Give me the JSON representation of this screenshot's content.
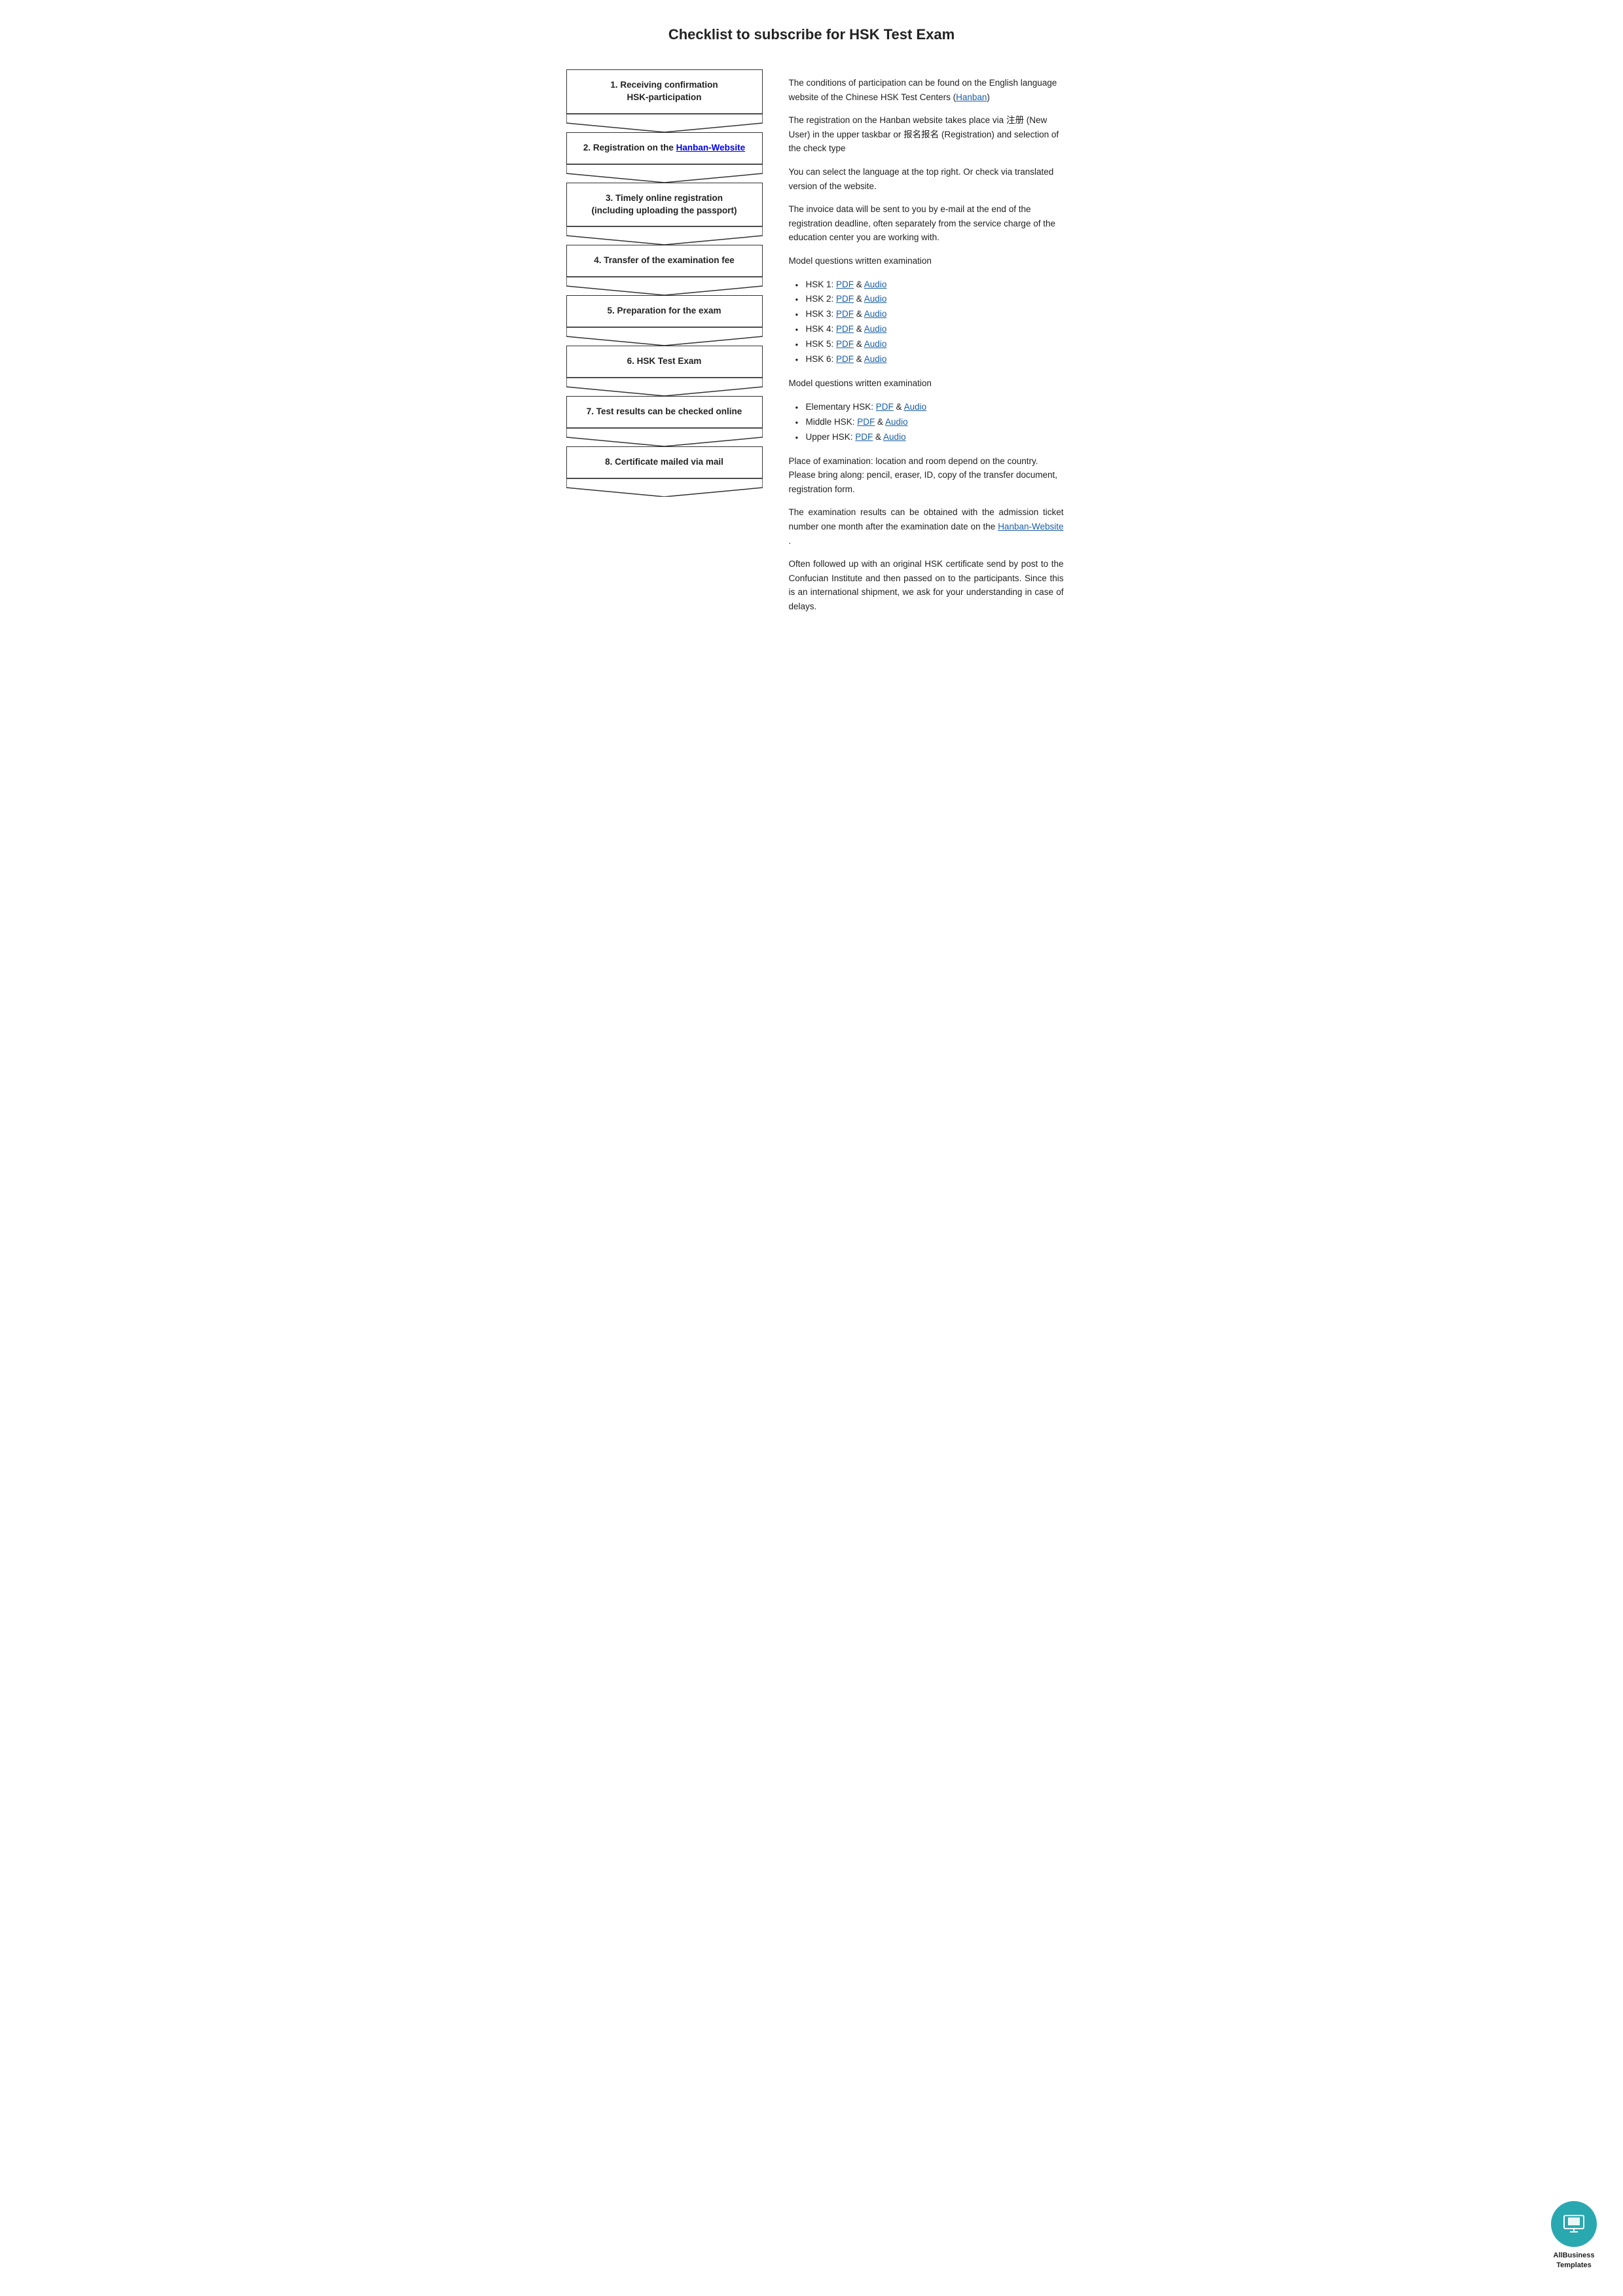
{
  "title": "Checklist to subscribe for HSK Test Exam",
  "steps": [
    {
      "id": 1,
      "label": "1. Receiving confirmation\nHSK-participation"
    },
    {
      "id": 2,
      "label": "2. Registration on the Hanban-\nWebsite",
      "hasLink": true,
      "linkText": "Hanban-\nWebsite",
      "preText": "2. Registration on the ",
      "linkHref": "#"
    },
    {
      "id": 3,
      "label": "3. Timely online registration\n(including uploading the passport)"
    },
    {
      "id": 4,
      "label": "4. Transfer of the examination fee"
    },
    {
      "id": 5,
      "label": "5. Preparation for the exam"
    },
    {
      "id": 6,
      "label": "6. HSK Test Exam"
    },
    {
      "id": 7,
      "label": "7. Test results can be checked online"
    },
    {
      "id": 8,
      "label": "8. Certificate mailed via mail"
    }
  ],
  "right": {
    "para1": "The conditions of participation can be found on the English language website of the Chinese HSK Test Centers  (",
    "para1_link": "Hanban",
    "para1_end": ")",
    "para2": "The registration on the Hanban website takes place via 注册 (New User) in the upper taskbar or 报名报名 (Registration) and selection of the check type",
    "para3": "You can select the language at the top right. Or check via translated version of the website.",
    "para4": "The invoice data will be sent to you by e-mail at the end of the registration deadline, often separately from the service charge of the education center you are working with.",
    "section1_label": "Model questions written examination",
    "hsk_items": [
      {
        "label": "HSK 1: ",
        "link1": "PDF",
        "sep": " & ",
        "link2": "Audio"
      },
      {
        "label": "HSK 2: ",
        "link1": "PDF",
        "sep": " & ",
        "link2": "Audio"
      },
      {
        "label": "HSK 3: ",
        "link1": "PDF",
        "sep": " & ",
        "link2": "Audio"
      },
      {
        "label": "HSK 4: ",
        "link1": "PDF",
        "sep": " & ",
        "link2": "Audio"
      },
      {
        "label": "HSK 5: ",
        "link1": "PDF",
        "sep": " & ",
        "link2": "Audio"
      },
      {
        "label": "HSK 6: ",
        "link1": "PDF",
        "sep": " & ",
        "link2": "Audio"
      }
    ],
    "section2_label": "Model questions written examination",
    "hsk_items2": [
      {
        "label": "Elementary HSK: ",
        "link1": "PDF",
        "sep": " & ",
        "link2": "Audio"
      },
      {
        "label": "Middle HSK: ",
        "link1": "PDF",
        "sep": " & ",
        "link2": "Audio"
      },
      {
        "label": "Upper HSK: ",
        "link1": "PDF",
        "sep": " & ",
        "link2": "Audio"
      }
    ],
    "para5": "Place of examination: location and room depend on the country. Please bring along: pencil, eraser, ID, copy of the transfer document, registration form.",
    "para6_before": "The examination results can be obtained with the admission ticket number one month after the examination date on the ",
    "para6_link": "Hanban-Website",
    "para6_after": " .",
    "para7": "Often followed up with an original HSK certificate send by post to the Confucian Institute and then passed on to the participants. Since this is an international shipment, we ask for your understanding in case of delays."
  },
  "logo": {
    "text1": "AllBusiness",
    "text2": "Templates"
  }
}
